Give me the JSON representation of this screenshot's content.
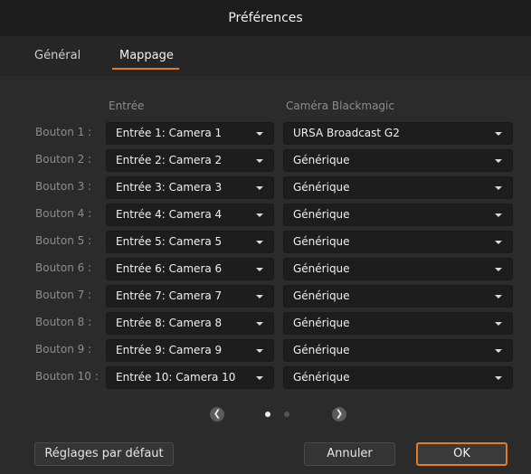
{
  "title": "Préférences",
  "tabs": [
    {
      "label": "Général",
      "active": false
    },
    {
      "label": "Mappage",
      "active": true
    }
  ],
  "columns": {
    "input": "Entrée",
    "camera": "Caméra Blackmagic"
  },
  "rows": [
    {
      "label": "Bouton 1 :",
      "input": "Entrée 1: Camera 1",
      "camera": "URSA Broadcast G2"
    },
    {
      "label": "Bouton 2 :",
      "input": "Entrée 2: Camera 2",
      "camera": "Générique"
    },
    {
      "label": "Bouton 3 :",
      "input": "Entrée 3: Camera 3",
      "camera": "Générique"
    },
    {
      "label": "Bouton 4 :",
      "input": "Entrée 4: Camera 4",
      "camera": "Générique"
    },
    {
      "label": "Bouton 5 :",
      "input": "Entrée 5: Camera 5",
      "camera": "Générique"
    },
    {
      "label": "Bouton 6 :",
      "input": "Entrée 6: Camera 6",
      "camera": "Générique"
    },
    {
      "label": "Bouton 7 :",
      "input": "Entrée 7: Camera 7",
      "camera": "Générique"
    },
    {
      "label": "Bouton 8 :",
      "input": "Entrée 8: Camera 8",
      "camera": "Générique"
    },
    {
      "label": "Bouton 9 :",
      "input": "Entrée 9: Camera 9",
      "camera": "Générique"
    },
    {
      "label": "Bouton 10 :",
      "input": "Entrée 10: Camera 10",
      "camera": "Générique"
    }
  ],
  "pagination": {
    "pages": 2,
    "current": 1
  },
  "footer": {
    "reset": "Réglages par défaut",
    "cancel": "Annuler",
    "ok": "OK"
  },
  "colors": {
    "accent": "#e57a2b"
  },
  "icons": [
    "chevron-left-icon",
    "chevron-right-icon",
    "dropdown-caret-icon"
  ]
}
